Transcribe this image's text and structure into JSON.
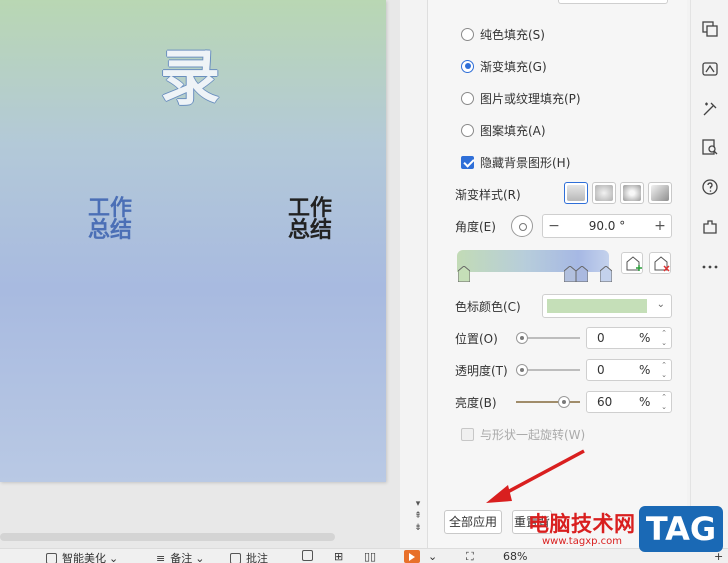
{
  "slide": {
    "big_char": "录",
    "text1_line1": "工作",
    "text1_line2": "总结",
    "text2_line1": "工作",
    "text2_line2": "总结"
  },
  "fill_options": [
    {
      "label": "纯色填充(S)",
      "selected": false
    },
    {
      "label": "渐变填充(G)",
      "selected": true
    },
    {
      "label": "图片或纹理填充(P)",
      "selected": false
    },
    {
      "label": "图案填充(A)",
      "selected": false
    }
  ],
  "hide_bg": {
    "label": "隐藏背景图形(H)",
    "checked": true
  },
  "gradient": {
    "style_label": "渐变样式(R)",
    "angle_label": "角度(E)",
    "angle_value": "90.0 °",
    "stop_color_label": "色标颜色(C)",
    "stop_color": "#c5dfb8",
    "position_label": "位置(O)",
    "position_value": "0",
    "transparency_label": "透明度(T)",
    "transparency_value": "0",
    "brightness_label": "亮度(B)",
    "brightness_value": "60",
    "percent_unit": "%",
    "rotate_label": "与形状一起旋转(W)"
  },
  "buttons": {
    "apply_all": "全部应用",
    "reset": "重置背景"
  },
  "statusbar": {
    "beautify": "智能美化",
    "notes": "备注",
    "comments": "批注",
    "zoom": "68%"
  },
  "overlay": {
    "watermark": "电脑技术网",
    "watermark_url": "www.tagxp.com",
    "tag": "TAG"
  },
  "colors": {
    "accent": "#2f6fd8",
    "watermark": "#d91f1f",
    "tag_bg": "#1a69b5"
  }
}
